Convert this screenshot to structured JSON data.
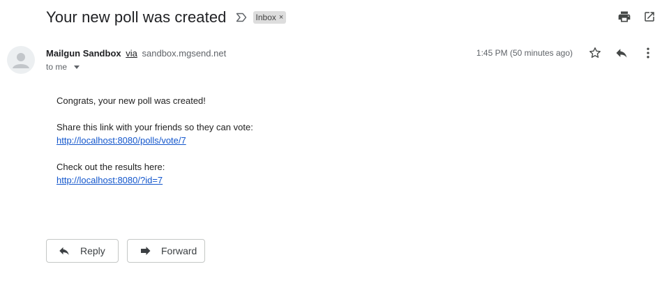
{
  "header": {
    "subject": "Your new poll was created",
    "label": "Inbox",
    "label_remove": "×"
  },
  "sender": {
    "name": "Mailgun Sandbox",
    "via": "via",
    "domain": "sandbox.mgsend.net",
    "to": "to me",
    "timestamp": "1:45 PM (50 minutes ago)"
  },
  "body": {
    "line1": "Congrats, your new poll was created!",
    "line2": "Share this link with your friends so they can vote:",
    "link1": "http://localhost:8080/polls/vote/7",
    "line3": "Check out the results here:",
    "link2": "http://localhost:8080/?id=7"
  },
  "actions": {
    "reply_label": "Reply",
    "forward_label": "Forward"
  },
  "icons": {
    "importance": "label-importance-icon",
    "print": "print-icon",
    "open_new_window": "open-in-new-window-icon",
    "star": "star-icon",
    "reply": "reply-icon",
    "more": "more-vert-icon",
    "forward": "forward-icon",
    "avatar": "person-avatar-icon"
  },
  "colors": {
    "text": "#202124",
    "muted": "#5f6368",
    "link": "#1155cc",
    "chip_bg": "#dddddd",
    "border": "#c4c7c5"
  }
}
